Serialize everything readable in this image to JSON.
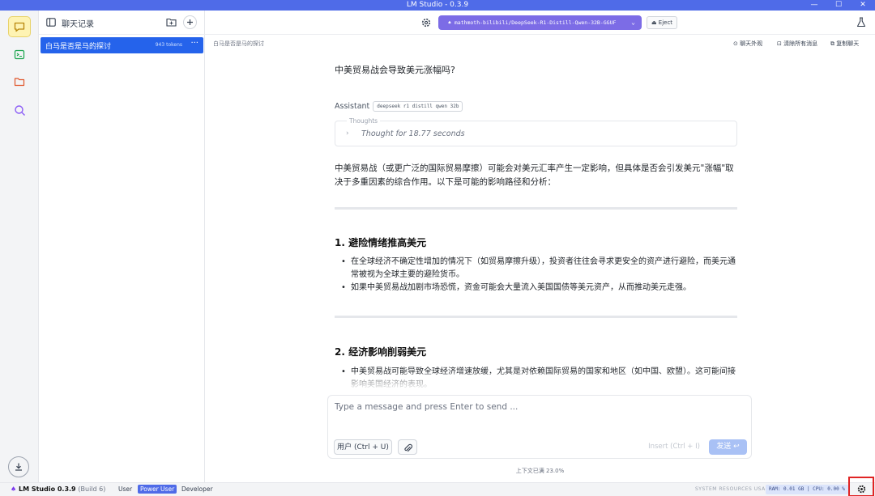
{
  "window": {
    "title": "LM Studio - 0.3.9",
    "controls": [
      "—",
      "☐",
      "✕"
    ]
  },
  "sidebar": {
    "items": [
      {
        "name": "chat",
        "icon": "chat-bubble-icon",
        "active": true
      },
      {
        "name": "terminal",
        "icon": "terminal-icon",
        "active": false
      },
      {
        "name": "models",
        "icon": "folder-icon",
        "active": false
      },
      {
        "name": "search",
        "icon": "search-icon",
        "active": false
      },
      {
        "name": "downloads",
        "icon": "download-icon",
        "active": false
      }
    ]
  },
  "chat_list": {
    "header_label": "聊天记录",
    "items": [
      {
        "title": "白马是否是马的探讨",
        "tokens": "943 tokens",
        "more": "···"
      }
    ]
  },
  "header": {
    "model_name": "mathmoth-bilibili/DeepSeek-R1-Distill-Qwen-32B-GGUF",
    "eject_label": "Eject"
  },
  "subheader": {
    "breadcrumb": "白马是否是马的探讨",
    "actions": [
      "聊天外观",
      "清除所有消息",
      "复制聊天"
    ]
  },
  "conversation": {
    "user_question": "中美贸易战会导致美元涨幅吗?",
    "assistant_label": "Assistant",
    "model_tag": "deepseek r1 distill qwen 32b",
    "thoughts_label": "Thoughts",
    "thoughts_text": "Thought for 18.77 seconds",
    "intro": "中美贸易战（或更广泛的国际贸易摩擦）可能会对美元汇率产生一定影响，但具体是否会引发美元\"涨幅\"取决于多重因素的综合作用。以下是可能的影响路径和分析：",
    "sections": [
      {
        "heading": "1. 避险情绪推高美元",
        "bullets": [
          "在全球经济不确定性增加的情况下（如贸易摩擦升级），投资者往往会寻求更安全的资产进行避险，而美元通常被视为全球主要的避险货币。",
          "如果中美贸易战加剧市场恐慌，资金可能会大量流入美国国债等美元资产，从而推动美元走强。"
        ]
      },
      {
        "heading": "2. 经济影响削弱美元",
        "bullets": [
          "中美贸易战可能导致全球经济增速放缓，尤其是对依赖国际贸易的国家和地区（如中国、欧盟）。这可能间接影响美国经济的表现。"
        ]
      }
    ]
  },
  "input": {
    "placeholder": "Type a message and press Enter to send ...",
    "role_label": "用户 (Ctrl + U)",
    "insert_label": "Insert (Ctrl + I)",
    "send_label": "发送 ↩"
  },
  "context_usage": "上下文已满 23.0%",
  "statusbar": {
    "app_name": "LM Studio 0.3.9",
    "build": "(Build 6)",
    "modes": [
      {
        "label": "User",
        "selected": false
      },
      {
        "label": "Power User",
        "selected": true
      },
      {
        "label": "Developer",
        "selected": false
      }
    ],
    "resources_label": "SYSTEM RESOURCES USAGE:",
    "ram_cpu": "RAM: 0.01 GB | CPU: 0.00 %"
  },
  "colors": {
    "titlebar": "#4f6be8",
    "accent": "#2563eb",
    "model_selector": "#7c6ce6",
    "highlight_border": "#e02424"
  }
}
